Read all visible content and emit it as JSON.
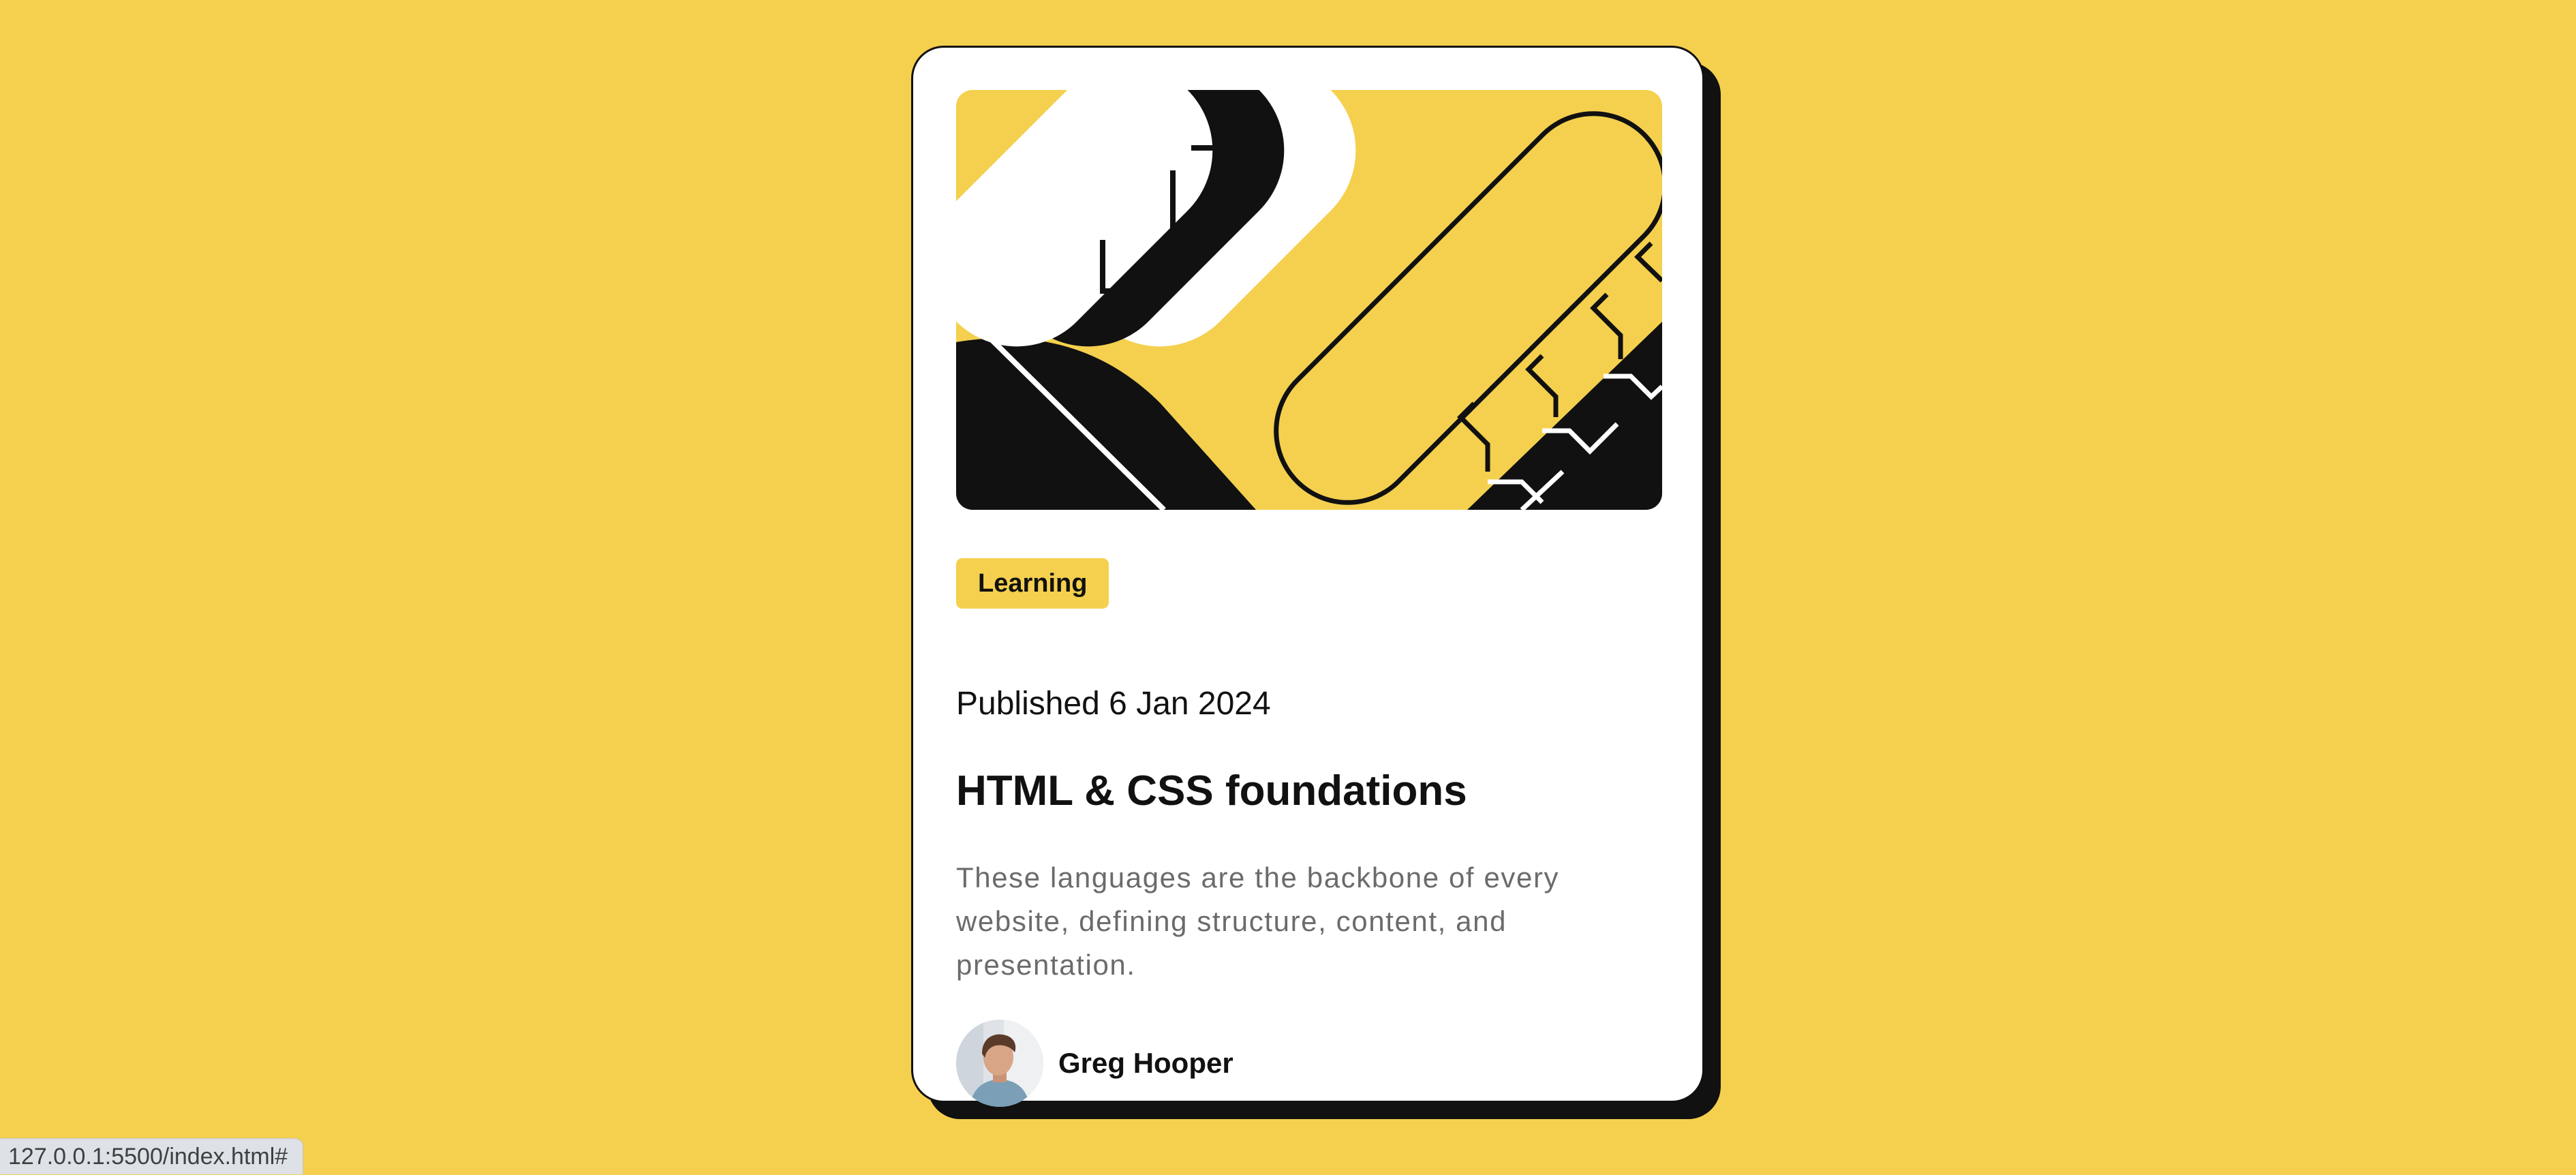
{
  "card": {
    "tag": "Learning",
    "published": "Published 6 Jan 2024",
    "title": "HTML & CSS foundations",
    "description": "These languages are the backbone of every website, defining structure, content, and presentation.",
    "author": {
      "name": "Greg Hooper"
    }
  },
  "status_bar": {
    "url": "127.0.0.1:5500/index.html#"
  },
  "colors": {
    "background": "#f4d04e",
    "card": "#ffffff",
    "ink": "#111111",
    "muted_text": "#6b6b6b"
  }
}
